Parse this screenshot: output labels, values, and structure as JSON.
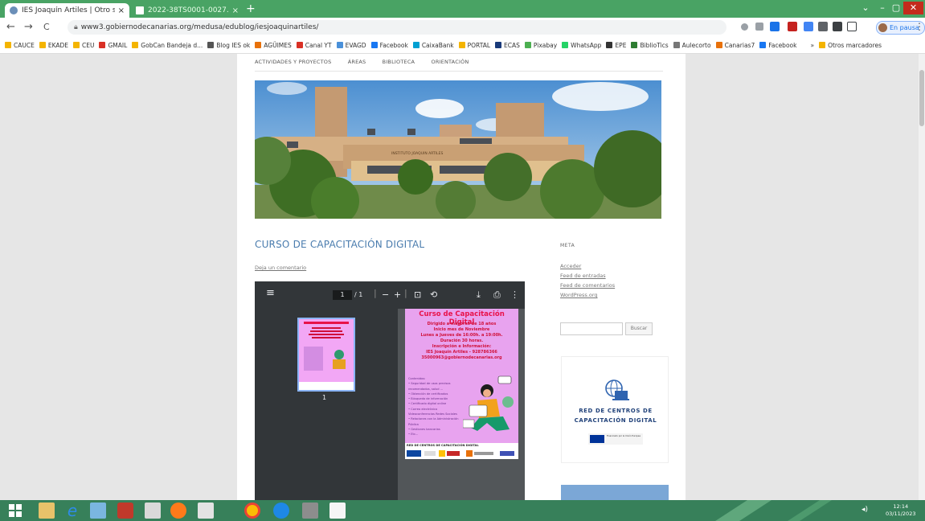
{
  "browser": {
    "tabs": [
      {
        "title": "IES Joaquín Artiles | Otro sitio m...",
        "close": "×",
        "active": true
      },
      {
        "title": "2022-38TS0001-0027. Logotipo",
        "close": "×",
        "active": false
      }
    ],
    "new_tab": "+",
    "window_buttons": [
      "⌄",
      "–",
      "▢",
      "✕"
    ],
    "url": "www3.gobiernodecanarias.org/medusa/edublog/iesjoaquinartiles/",
    "profile_label": "En pausa",
    "nav": {
      "back": "←",
      "forward": "→",
      "reload": "C",
      "menu": "⋮"
    },
    "bookmarks": [
      "CAUCE",
      "EKADE",
      "CEU",
      "GMAIL",
      "GobCan Bandeja d...",
      "Blog IES ok",
      "AGÜIMES",
      "Canal YT",
      "EVAGD",
      "Facebook",
      "CaixaBank",
      "PORTAL",
      "ECAS",
      "Pixabay",
      "WhatsApp",
      "EPE",
      "BiblioTics",
      "Aulecorto",
      "Canarias7",
      "Facebook",
      "»",
      "Otros marcadores"
    ],
    "bookmark_colors": [
      "#f4b400",
      "#f4b400",
      "#f4b400",
      "#d93025",
      "#f4b400",
      "#555",
      "#e8710a",
      "#d93025",
      "#4a90d9",
      "#1877f2",
      "#00a0d2",
      "#f4b400",
      "#1a3a7a",
      "#4caf50",
      "#25d366",
      "#333",
      "#2e7d32",
      "#777",
      "#e8710a",
      "#1877f2",
      "#fff",
      "#f4b400"
    ]
  },
  "site": {
    "nav": [
      "ACTIVIDADES Y PROYECTOS",
      "ÁREAS",
      "BIBLIOTECA",
      "ORIENTACIÓN"
    ],
    "post_title": "CURSO DE CAPACITACIÓN DIGITAL",
    "comment_link": "Deja un comentario",
    "header_school_sign": "INSTITUTO JOAQUIN ARTILES"
  },
  "pdf": {
    "menu_icon": "≡",
    "page_current": "1",
    "page_total": "/ 1",
    "zoom_out": "−",
    "zoom_in": "+",
    "thumbnail_number": "1",
    "poster": {
      "title": "Curso de Capacitación Digital",
      "lines": [
        "Dirigido a mayores de 18 años",
        "Inicio mes de Noviembre",
        "Lunes a Jueves de 16:00h. a 19:00h.",
        "Duración 30 horas.",
        "Inscripción e Información:",
        "IES Joaquín Artiles - 928786366",
        "35000963@gobiernodecanarias.org"
      ],
      "contents_heading": "Contenidos:",
      "contents": [
        "• Seguridad de usos precisos",
        "  recomendados, salud ...",
        "• Obtención de certificados",
        "• Búsqueda de información",
        "• Certificado digital online",
        "• Correo electrónico",
        "  Videoconferencias Redes Sociales",
        "• Relaciones con la Administración",
        "  Pública",
        "• Gestiones bancarias",
        "• Etc..."
      ],
      "footer": "RED DE CENTROS DE CAPACITACIÓN DIGITAL"
    }
  },
  "sidebar": {
    "meta_heading": "META",
    "links": [
      "Acceder",
      "Feed de entradas",
      "Feed de comentarios",
      "WordPress.org"
    ],
    "search_button": "Buscar",
    "badge_line1": "RED DE CENTROS DE",
    "badge_line2": "CAPACITACIÓN DIGITAL",
    "badge_eu": "Financiado por la Unión Europea"
  },
  "taskbar": {
    "time": "12:14",
    "date": "03/11/2023"
  }
}
